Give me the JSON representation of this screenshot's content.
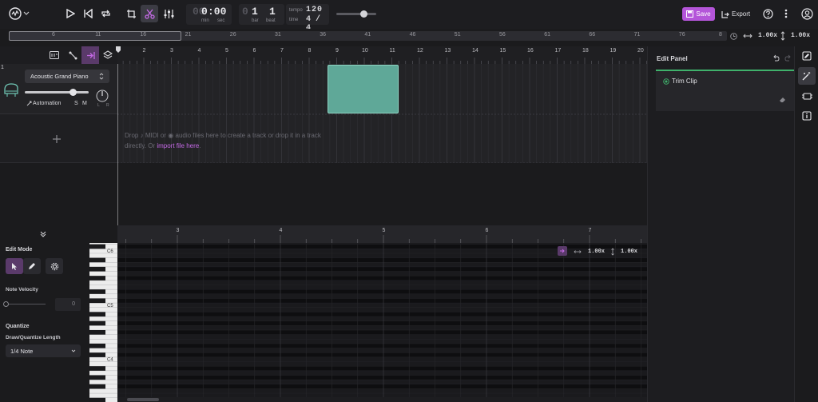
{
  "transport": {
    "time_min": "0",
    "time_sec": ":00",
    "time_prefix": "00",
    "time_min_label": "min",
    "time_sec_label": "sec",
    "bar_value": "1",
    "bar_prefix": "0",
    "beat_value": "1",
    "bar_label": "bar",
    "beat_label": "beat",
    "tempo_label": "tempo",
    "tempo_value": "120",
    "time_label": "time",
    "time_signature": "4 / 4"
  },
  "header": {
    "save_label": "Save",
    "export_label": "Export"
  },
  "overview": {
    "numbers": [
      "6",
      "11",
      "16",
      "21",
      "26",
      "31",
      "36",
      "41",
      "46",
      "51",
      "56",
      "61",
      "66",
      "71",
      "76",
      "8"
    ],
    "h_zoom": "1.00x",
    "v_zoom": "1.00x"
  },
  "ruler": {
    "bars": [
      "2",
      "3",
      "4",
      "5",
      "6",
      "7",
      "8",
      "9",
      "10",
      "11",
      "12",
      "13",
      "14",
      "15",
      "16",
      "17",
      "18",
      "19",
      "20"
    ]
  },
  "track": {
    "number": "1",
    "instrument": "Acoustic Grand Piano",
    "automation_label": "Automation",
    "solo_label": "S",
    "mute_label": "M",
    "volume_fraction": 0.75
  },
  "drop_zone": {
    "line1_a": "Drop",
    "line1_b": "MIDI or",
    "line1_c": "audio files here to create a track or drop it in a track",
    "line2_a": "directly. Or",
    "link": "import file here",
    "line2_b": "."
  },
  "piano_roll": {
    "ruler_bars": [
      "3",
      "4",
      "5",
      "6",
      "7"
    ],
    "note_labels": [
      "C6",
      "C5",
      "C4"
    ],
    "h_zoom": "1.00x",
    "v_zoom": "1.00x"
  },
  "edit_mode": {
    "title": "Edit Mode",
    "velocity_label": "Note Velocity",
    "velocity_value": "0",
    "quantize_title": "Quantize",
    "quantize_sub": "Draw/Quantize Length",
    "quantize_value": "1/4 Note"
  },
  "edit_panel": {
    "title": "Edit Panel",
    "trim_clip": "Trim Clip"
  },
  "colors": {
    "accent": "#b455d9",
    "clip": "#5fa898",
    "panel_line": "#3fb16b"
  }
}
